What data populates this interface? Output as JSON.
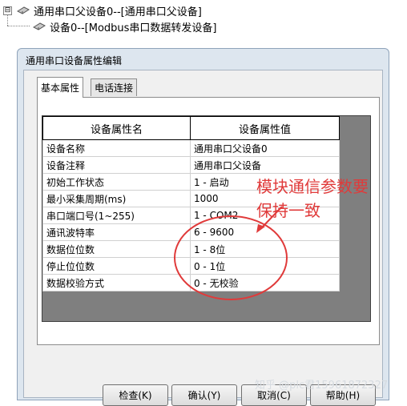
{
  "tree": {
    "expander": "⊟",
    "root_label": "通用串口父设备0--[通用串口父设备]",
    "child_label": "设备0--[Modbus串口数据转发设备]"
  },
  "dialog": {
    "title": "通用串口设备属性编辑",
    "tabs": [
      {
        "label": "基本属性",
        "active": true
      },
      {
        "label": "电话连接",
        "active": false
      }
    ],
    "grid": {
      "headers": [
        "设备属性名",
        "设备属性值"
      ],
      "rows": [
        {
          "name": "设备名称",
          "value": "通用串口父设备0"
        },
        {
          "name": "设备注释",
          "value": "通用串口父设备"
        },
        {
          "name": "初始工作状态",
          "value": "1 - 启动"
        },
        {
          "name": "最小采集周期(ms)",
          "value": "1000"
        },
        {
          "name": "串口端口号(1~255)",
          "value": "1 - COM2"
        },
        {
          "name": "通讯波特率",
          "value": "6 - 9600"
        },
        {
          "name": "数据位位数",
          "value": "1 - 8位"
        },
        {
          "name": "停止位位数",
          "value": "0 - 1位"
        },
        {
          "name": "数据校验方式",
          "value": "0 - 无校验"
        }
      ]
    },
    "buttons": {
      "check": "检查(K)",
      "confirm": "确认(Y)",
      "cancel": "取消(C)",
      "help": "帮助(H)"
    }
  },
  "annotation": {
    "line1": "模块通信参数要",
    "line2": "保持一致",
    "color": "#e03a3a"
  },
  "watermark": "知乎 @plc君15961872327"
}
